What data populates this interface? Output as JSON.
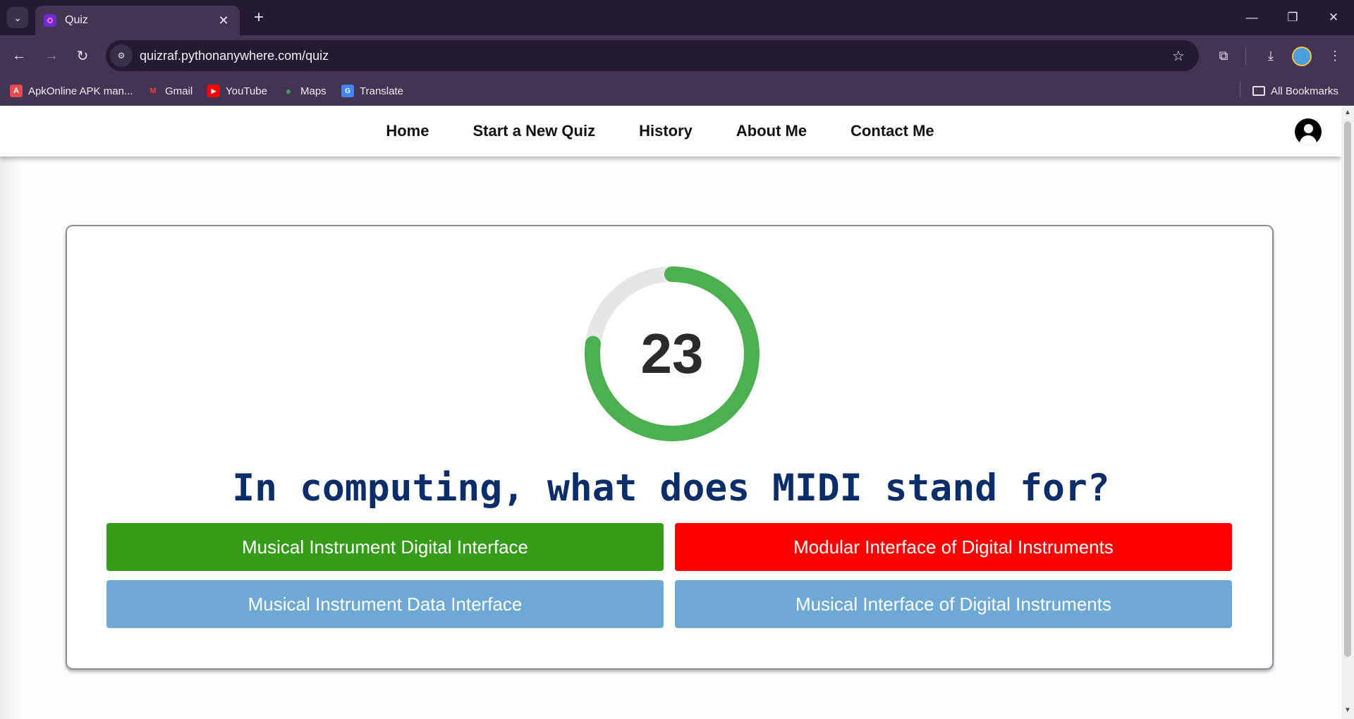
{
  "browser": {
    "tab": {
      "title": "Quiz"
    },
    "url": "quizraf.pythonanywhere.com/quiz",
    "bookmarks": [
      {
        "label": "ApkOnline APK man...",
        "icon": "apkonline-icon",
        "color": "#e54b4b"
      },
      {
        "label": "Gmail",
        "icon": "gmail-icon",
        "color": "#ea4335"
      },
      {
        "label": "YouTube",
        "icon": "youtube-icon",
        "color": "#ff0000"
      },
      {
        "label": "Maps",
        "icon": "maps-icon",
        "color": "#34a853"
      },
      {
        "label": "Translate",
        "icon": "translate-icon",
        "color": "#4285f4"
      }
    ],
    "all_bookmarks_label": "All Bookmarks"
  },
  "nav": {
    "links": [
      "Home",
      "Start a New Quiz",
      "History",
      "About Me",
      "Contact Me"
    ]
  },
  "quiz": {
    "timer": {
      "value": "23",
      "progress": 0.77,
      "color": "#4caf50",
      "track_color": "#e6e6e6"
    },
    "question": "In computing, what does MIDI stand for?",
    "answers": [
      {
        "text": "Musical Instrument Digital Interface",
        "state": "correct",
        "color": "#379b1a"
      },
      {
        "text": "Modular Interface of Digital Instruments",
        "state": "incorrect",
        "color": "#ff0000"
      },
      {
        "text": "Musical Instrument Data Interface",
        "state": "neutral",
        "color": "#6ea9d6"
      },
      {
        "text": "Musical Interface of Digital Instruments",
        "state": "neutral",
        "color": "#6ea9d6"
      }
    ]
  }
}
